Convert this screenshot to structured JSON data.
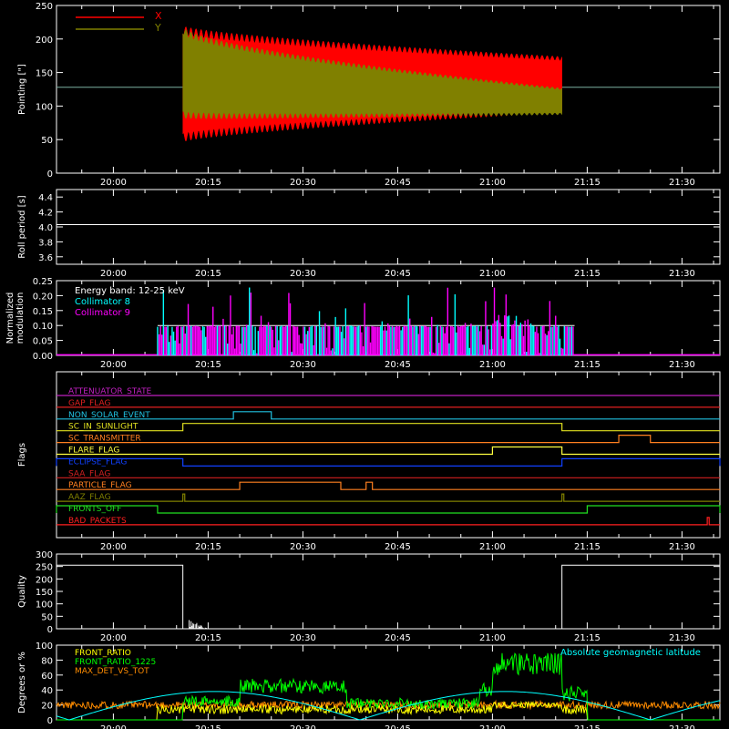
{
  "colors": {
    "background": "#000000",
    "axes": "#ffffff",
    "x_series": "#ff0000",
    "y_series": "#808000",
    "collimator8": "#00ffff",
    "collimator9": "#ff00ff",
    "front_ratio": "#ffff00",
    "front_ratio_1225": "#00ff00",
    "max_det_vs_tot": "#ff8c00",
    "geomag": "#00ffff"
  },
  "time_axis": {
    "tick_labels": [
      "20:00",
      "20:15",
      "20:30",
      "20:45",
      "21:00",
      "21:15",
      "21:30"
    ],
    "tick_values_min": [
      0,
      15,
      30,
      45,
      60,
      75,
      90
    ],
    "range_min": [
      -9,
      96
    ]
  },
  "chart_data": [
    {
      "id": "pointing",
      "type": "line",
      "ylabel": "Pointing [\"]",
      "ylim": [
        0,
        250
      ],
      "yticks": [
        0,
        50,
        100,
        150,
        200,
        250
      ],
      "reference_line": 128,
      "legend": [
        {
          "name": "X",
          "color": "#ff0000"
        },
        {
          "name": "Y",
          "color": "#808000"
        }
      ],
      "series": [
        {
          "name": "X",
          "x_min": [
            11,
            71
          ],
          "center": [
            133,
            132
          ],
          "amplitude_start": 87,
          "amplitude_end": 42
        },
        {
          "name": "Y",
          "x_min": [
            11,
            71
          ],
          "center": [
            150,
            107
          ],
          "amplitude_start": 68,
          "amplitude_end": 20
        }
      ]
    },
    {
      "id": "roll",
      "type": "line",
      "ylabel": "Roll period [s]",
      "ylim": [
        3.5,
        4.5
      ],
      "yticks": [
        3.6,
        3.8,
        4.0,
        4.2,
        4.4
      ],
      "tick_labels": [
        "3.6",
        "3.8",
        "4.0",
        "4.2",
        "4.4"
      ],
      "value": 4.03
    },
    {
      "id": "modulation",
      "type": "bar",
      "ylabel": "Normalized modulation",
      "ylabel_lines": [
        "Normalized",
        "modulation"
      ],
      "ylim": [
        0,
        0.25
      ],
      "yticks": [
        0.0,
        0.05,
        0.1,
        0.15,
        0.2,
        0.25
      ],
      "tick_labels": [
        "0.00",
        "0.05",
        "0.10",
        "0.15",
        "0.20",
        "0.25"
      ],
      "annotation": "Energy band: 12-25 keV",
      "legend": [
        {
          "name": "Collimator 8",
          "color": "#00ffff"
        },
        {
          "name": "Collimator 9",
          "color": "#ff00ff"
        }
      ],
      "active_range_min": [
        7,
        73
      ],
      "base_value": 0.1
    },
    {
      "id": "flags",
      "type": "line",
      "ylabel": "Flags",
      "flags": [
        {
          "name": "ATTENUATOR_STATE",
          "color": "#c020c0",
          "on": []
        },
        {
          "name": "GAP_FLAG",
          "color": "#e02020",
          "on": []
        },
        {
          "name": "NON_SOLAR_EVENT",
          "color": "#20c0e0",
          "on": [
            [
              19,
              25
            ]
          ]
        },
        {
          "name": "SC_IN_SUNLIGHT",
          "color": "#e0e020",
          "on": [
            [
              11,
              71
            ]
          ]
        },
        {
          "name": "SC_TRANSMITTER",
          "color": "#ff8020",
          "on": [
            [
              80,
              85
            ]
          ]
        },
        {
          "name": "FLARE_FLAG",
          "color": "#ffff40",
          "on": [
            [
              60,
              71
            ]
          ]
        },
        {
          "name": "ECLIPSE_FLAG",
          "color": "#1040ff",
          "on": [
            [
              -9,
              11
            ],
            [
              71,
              96
            ]
          ]
        },
        {
          "name": "SAA_FLAG",
          "color": "#d02020",
          "on": []
        },
        {
          "name": "PARTICLE_FLAG",
          "color": "#ff8020",
          "on": [
            [
              20,
              36
            ],
            [
              40,
              41
            ]
          ]
        },
        {
          "name": "AAZ_FLAG",
          "color": "#808000",
          "on": [
            [
              11,
              11.3
            ],
            [
              71,
              71.3
            ]
          ]
        },
        {
          "name": "FRONTS_OFF",
          "color": "#20e020",
          "on": [
            [
              -9,
              7
            ],
            [
              75,
              96
            ]
          ]
        },
        {
          "name": "BAD_PACKETS",
          "color": "#ff2020",
          "on": [
            [
              94,
              94.3
            ]
          ]
        }
      ]
    },
    {
      "id": "quality",
      "type": "line",
      "ylabel": "Quality",
      "ylim": [
        0,
        300
      ],
      "yticks": [
        0,
        50,
        100,
        150,
        200,
        250,
        300
      ],
      "tick_labels": [
        "0",
        "50",
        "100",
        "150",
        "200",
        "250",
        "300"
      ],
      "segments": [
        {
          "x_min": [
            -9,
            11
          ],
          "value": 255
        },
        {
          "x_min": [
            11,
            71
          ],
          "value": 0
        },
        {
          "x_min": [
            71,
            96
          ],
          "value": 255
        }
      ]
    },
    {
      "id": "ratios",
      "type": "line",
      "ylabel": "Degrees or %",
      "ylim": [
        0,
        100
      ],
      "yticks": [
        0,
        20,
        40,
        60,
        80,
        100
      ],
      "tick_labels": [
        "0",
        "20",
        "40",
        "60",
        "80",
        "100"
      ],
      "annotation": "Absolute geomagnetic latitude",
      "legend": [
        {
          "name": "FRONT_RATIO",
          "color": "#ffff00"
        },
        {
          "name": "FRONT_RATIO_1225",
          "color": "#00ff00"
        },
        {
          "name": "MAX_DET_VS_TOT",
          "color": "#ff8c00"
        }
      ]
    }
  ]
}
